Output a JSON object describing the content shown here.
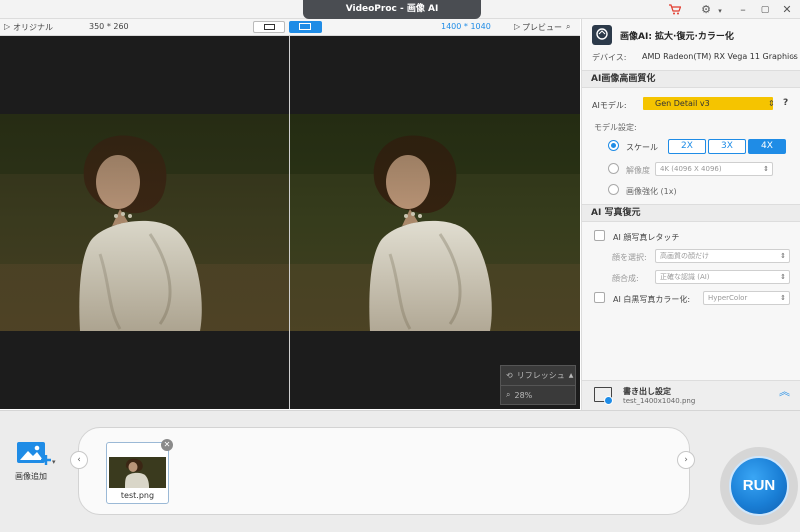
{
  "app": {
    "title": "VideoProc - 画像 AI"
  },
  "viewer": {
    "original_label": "オリジナル",
    "original_size": "350 * 260",
    "output_size": "1400 * 1040",
    "preview_label": "プレビュー",
    "refresh_label": "リフレッシュ",
    "zoom": "28%"
  },
  "panel": {
    "header_title": "画像AI: 拡大·復元·カラー化",
    "device_label": "デバイス:",
    "device_value": "AMD Radeon(TM) RX Vega 11 Graphics",
    "section_enhance": "AI画像高画質化",
    "model_label": "AIモデル:",
    "model_value": "Gen Detail v3",
    "model_settings_label": "モデル設定:",
    "scale_label": "スケール",
    "scale_options": [
      "2X",
      "3X",
      "4X"
    ],
    "scale_selected": "4X",
    "resolution_label": "解像度",
    "resolution_value": "4K (4096 X 4096)",
    "enhance_label": "画像強化 (1x)",
    "section_photo": "AI 写真復元",
    "face_retouch_label": "AI 顔写真レタッチ",
    "face_select_label": "顔を選択:",
    "face_select_value": "高画質の顔だけ",
    "face_merge_label": "顔合成:",
    "face_merge_value": "正確な認識 (AI)",
    "colorize_label": "AI 白黒写真カラー化:",
    "colorize_value": "HyperColor",
    "export_title": "書き出し設定",
    "export_file": "test_1400x1040.png"
  },
  "bottom": {
    "add_image_label": "画像追加",
    "thumb_name": "test.png",
    "run_label": "RUN"
  },
  "colors": {
    "accent": "#1f8ce6",
    "model_badge": "#f5c400"
  }
}
